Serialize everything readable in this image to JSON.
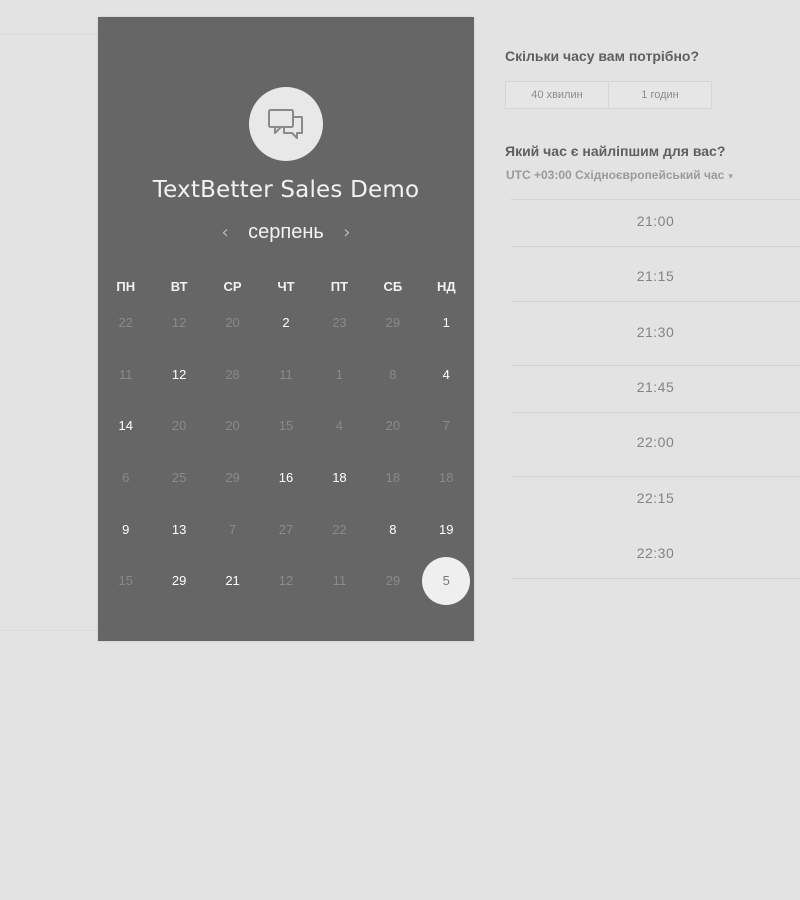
{
  "calendar": {
    "title": "TextBetter Sales Demo",
    "month": "серпень",
    "prev_arrow": "‹",
    "next_arrow": "›",
    "weekdays": [
      "ПН",
      "ВТ",
      "СР",
      "ЧТ",
      "ПТ",
      "СБ",
      "НД"
    ],
    "weeks": [
      [
        {
          "d": "22",
          "a": false
        },
        {
          "d": "12",
          "a": false
        },
        {
          "d": "20",
          "a": false
        },
        {
          "d": "2",
          "a": true
        },
        {
          "d": "23",
          "a": false
        },
        {
          "d": "29",
          "a": false
        },
        {
          "d": "1",
          "a": true
        }
      ],
      [
        {
          "d": "11",
          "a": false
        },
        {
          "d": "12",
          "a": true
        },
        {
          "d": "28",
          "a": false
        },
        {
          "d": "11",
          "a": false
        },
        {
          "d": "1",
          "a": false
        },
        {
          "d": "8",
          "a": false
        },
        {
          "d": "4",
          "a": true
        }
      ],
      [
        {
          "d": "14",
          "a": true
        },
        {
          "d": "20",
          "a": false
        },
        {
          "d": "20",
          "a": false
        },
        {
          "d": "15",
          "a": false
        },
        {
          "d": "4",
          "a": false
        },
        {
          "d": "20",
          "a": false
        },
        {
          "d": "7",
          "a": false
        }
      ],
      [
        {
          "d": "6",
          "a": false
        },
        {
          "d": "25",
          "a": false
        },
        {
          "d": "29",
          "a": false
        },
        {
          "d": "16",
          "a": true
        },
        {
          "d": "18",
          "a": true
        },
        {
          "d": "18",
          "a": false
        },
        {
          "d": "18",
          "a": false
        }
      ],
      [
        {
          "d": "9",
          "a": true
        },
        {
          "d": "13",
          "a": true
        },
        {
          "d": "7",
          "a": false
        },
        {
          "d": "27",
          "a": false
        },
        {
          "d": "22",
          "a": false
        },
        {
          "d": "8",
          "a": true
        },
        {
          "d": "19",
          "a": true
        }
      ],
      [
        {
          "d": "15",
          "a": false
        },
        {
          "d": "29",
          "a": true
        },
        {
          "d": "21",
          "a": true
        },
        {
          "d": "12",
          "a": false
        },
        {
          "d": "11",
          "a": false
        },
        {
          "d": "29",
          "a": false
        },
        {
          "d": "5",
          "a": true,
          "selected": true
        }
      ]
    ]
  },
  "duration": {
    "question": "Скільки часу вам потрібно?",
    "options": [
      "40 хвилин",
      "1 годин"
    ]
  },
  "time": {
    "question": "Який час є найліпшим для вас?",
    "timezone": "UTC +03:00 Східноєвропейський час",
    "timezone_caret": "▾",
    "slots": [
      "21:00",
      "21:15",
      "21:30",
      "21:45",
      "22:00",
      "22:15",
      "22:30"
    ]
  },
  "colors": {
    "card": "#666666",
    "page": "#e3e3e3",
    "selected_day": "#efefef"
  },
  "icons": {
    "avatar": "chat-bubbles-icon"
  }
}
